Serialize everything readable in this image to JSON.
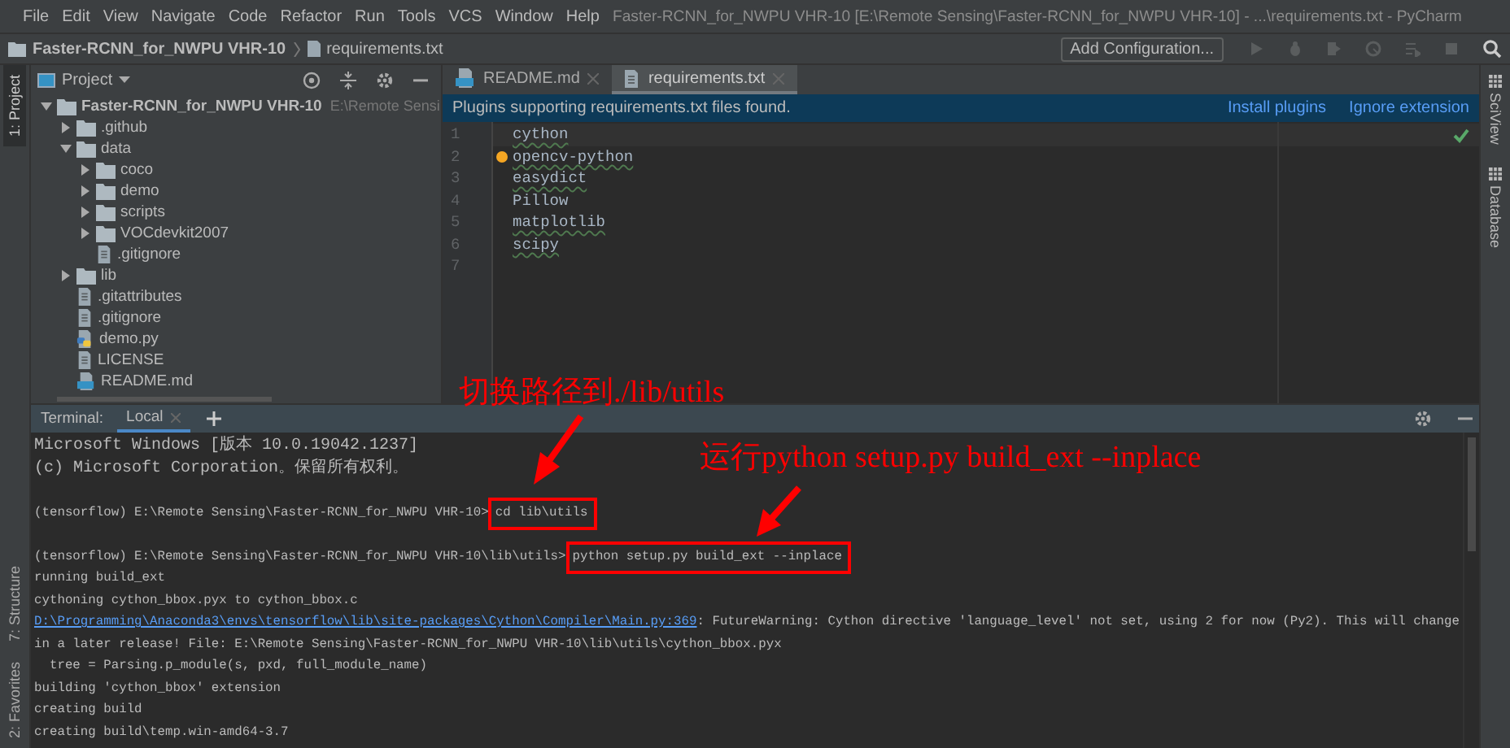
{
  "menu_bar": {
    "menus": [
      "File",
      "Edit",
      "View",
      "Navigate",
      "Code",
      "Refactor",
      "Run",
      "Tools",
      "VCS",
      "Window",
      "Help"
    ],
    "title": "Faster-RCNN_for_NWPU VHR-10 [E:\\Remote Sensing\\Faster-RCNN_for_NWPU VHR-10] - ...\\requirements.txt - PyCharm"
  },
  "nav_bar": {
    "breadcrumb": [
      "Faster-RCNN_for_NWPU VHR-10",
      "requirements.txt"
    ],
    "run_config": "Add Configuration..."
  },
  "left_tool_tabs_top": [
    {
      "label": "1: Project",
      "selected": true
    }
  ],
  "left_tool_tabs_bottom": [
    {
      "label": "7: Structure",
      "selected": false
    },
    {
      "label": "2: Favorites",
      "selected": false
    }
  ],
  "right_tool_tabs": [
    {
      "label": "SciView"
    },
    {
      "label": "Database"
    }
  ],
  "project_panel": {
    "title": "Project",
    "tree": [
      {
        "kind": "folder",
        "name": "Faster-RCNN_for_NWPU VHR-10",
        "path": "E:\\Remote Sensi",
        "expanded": true,
        "children": [
          {
            "kind": "folder",
            "name": ".github",
            "expanded": false
          },
          {
            "kind": "folder",
            "name": "data",
            "expanded": true,
            "children": [
              {
                "kind": "folder",
                "name": "coco",
                "expanded": false
              },
              {
                "kind": "folder",
                "name": "demo",
                "expanded": false
              },
              {
                "kind": "folder",
                "name": "scripts",
                "expanded": false
              },
              {
                "kind": "folder",
                "name": "VOCdevkit2007",
                "expanded": false
              },
              {
                "kind": "file",
                "name": ".gitignore"
              }
            ]
          },
          {
            "kind": "folder",
            "name": "lib",
            "expanded": false
          },
          {
            "kind": "file",
            "name": ".gitattributes"
          },
          {
            "kind": "file",
            "name": ".gitignore"
          },
          {
            "kind": "python",
            "name": "demo.py"
          },
          {
            "kind": "file",
            "name": "LICENSE"
          },
          {
            "kind": "markdown",
            "name": "README.md"
          }
        ]
      }
    ]
  },
  "editor": {
    "tabs": [
      {
        "label": "README.md",
        "kind": "markdown",
        "selected": false
      },
      {
        "label": "requirements.txt",
        "kind": "text",
        "selected": true
      }
    ],
    "notification": {
      "message": "Plugins supporting requirements.txt files found.",
      "actions": [
        "Install plugins",
        "Ignore extension"
      ]
    },
    "line_numbers": [
      "1",
      "2",
      "3",
      "4",
      "5",
      "6",
      "7"
    ],
    "lines": [
      {
        "text": "cython",
        "typo": true
      },
      {
        "text": "opencv-python",
        "typo": true
      },
      {
        "text": "easydict",
        "typo": true
      },
      {
        "text": "Pillow",
        "typo": false
      },
      {
        "text": "matplotlib",
        "typo": true
      },
      {
        "text": "scipy",
        "typo": true
      }
    ]
  },
  "terminal": {
    "title": "Terminal:",
    "tabs": [
      {
        "label": "Local",
        "selected": true
      }
    ],
    "lines": [
      {
        "kind": "banner",
        "text": "Microsoft Windows [版本 10.0.19042.1237]"
      },
      {
        "kind": "banner",
        "text": "(c) Microsoft Corporation。保留所有权利。"
      },
      {
        "kind": "blank"
      },
      {
        "kind": "command",
        "prompt": "(tensorflow) E:\\Remote Sensing\\Faster-RCNN_for_NWPU VHR-10>",
        "command": "cd lib\\utils"
      },
      {
        "kind": "blank"
      },
      {
        "kind": "command",
        "prompt": "(tensorflow) E:\\Remote Sensing\\Faster-RCNN_for_NWPU VHR-10\\lib\\utils>",
        "command": "python setup.py build_ext --inplace"
      },
      {
        "kind": "output",
        "text": "running build_ext"
      },
      {
        "kind": "output",
        "text": "cythoning cython_bbox.pyx to cython_bbox.c"
      },
      {
        "kind": "link",
        "link": "D:\\Programming\\Anaconda3\\envs\\tensorflow\\lib\\site-packages\\Cython\\Compiler\\Main.py:369",
        "text": ": FutureWarning: Cython directive 'language_level' not set, using 2 for now (Py2). This will change"
      },
      {
        "kind": "output",
        "text": "in a later release! File: E:\\Remote Sensing\\Faster-RCNN_for_NWPU VHR-10\\lib\\utils\\cython_bbox.pyx"
      },
      {
        "kind": "output",
        "text": "  tree = Parsing.p_module(s, pxd, full_module_name)"
      },
      {
        "kind": "output",
        "text": "building 'cython_bbox' extension"
      },
      {
        "kind": "output",
        "text": "creating build"
      },
      {
        "kind": "output",
        "text": "creating build\\temp.win-amd64-3.7"
      }
    ]
  },
  "annotations": [
    {
      "text": "切换路径到./lib/utils"
    },
    {
      "text": "运行python setup.py build_ext --inplace"
    }
  ]
}
